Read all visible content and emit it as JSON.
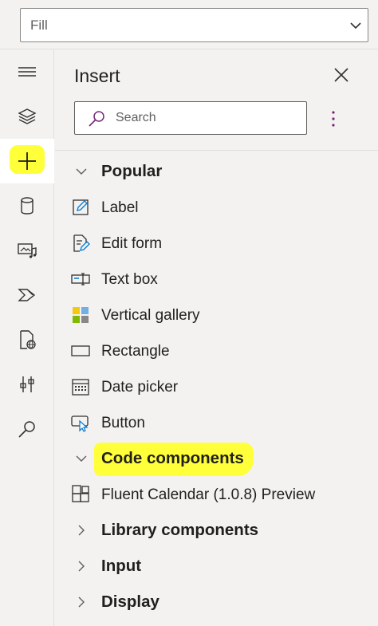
{
  "property_dropdown": {
    "value": "Fill"
  },
  "rail": {
    "items": [
      {
        "icon": "hamburger-icon"
      },
      {
        "icon": "layers-icon"
      },
      {
        "icon": "plus-icon",
        "active": true
      },
      {
        "icon": "database-icon"
      },
      {
        "icon": "media-icon"
      },
      {
        "icon": "power-automate-icon"
      },
      {
        "icon": "web-page-icon"
      },
      {
        "icon": "tools-icon"
      },
      {
        "icon": "search-icon"
      }
    ]
  },
  "pane": {
    "title": "Insert",
    "search": {
      "placeholder": "Search"
    },
    "groups": [
      {
        "label": "Popular",
        "expanded": true,
        "items": [
          {
            "label": "Label",
            "icon": "label-icon"
          },
          {
            "label": "Edit form",
            "icon": "edit-form-icon"
          },
          {
            "label": "Text box",
            "icon": "text-box-icon"
          },
          {
            "label": "Vertical gallery",
            "icon": "vertical-gallery-icon"
          },
          {
            "label": "Rectangle",
            "icon": "rectangle-icon"
          },
          {
            "label": "Date picker",
            "icon": "date-picker-icon"
          },
          {
            "label": "Button",
            "icon": "button-icon"
          }
        ]
      },
      {
        "label": "Code components",
        "expanded": true,
        "highlighted": true,
        "items": [
          {
            "label": "Fluent Calendar (1.0.8) Preview",
            "icon": "component-icon"
          }
        ]
      },
      {
        "label": "Library components",
        "expanded": false
      },
      {
        "label": "Input",
        "expanded": false
      },
      {
        "label": "Display",
        "expanded": false
      }
    ]
  },
  "colors": {
    "highlight": "#ffff3a",
    "background": "#f3f2f1",
    "accent_purple": "#742774"
  }
}
